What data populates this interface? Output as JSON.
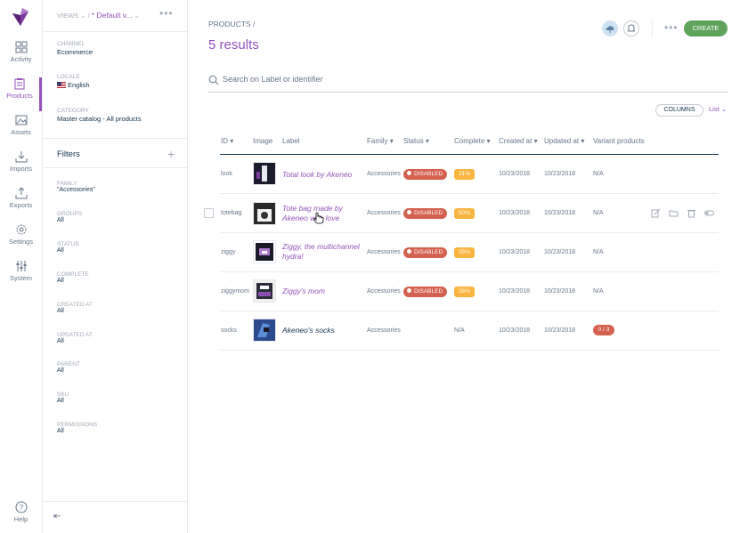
{
  "nav": {
    "items": [
      {
        "label": "Activity",
        "icon": "dashboard-icon"
      },
      {
        "label": "Products",
        "icon": "clipboard-icon"
      },
      {
        "label": "Assets",
        "icon": "image-icon"
      },
      {
        "label": "Imports",
        "icon": "download-icon"
      },
      {
        "label": "Exports",
        "icon": "upload-icon"
      },
      {
        "label": "Settings",
        "icon": "gear-icon"
      },
      {
        "label": "System",
        "icon": "sliders-icon"
      }
    ],
    "help": "Help"
  },
  "panel": {
    "views_label": "VIEWS",
    "view_name": "* Default v...",
    "channel_label": "CHANNEL",
    "channel_value": "Ecommerce",
    "locale_label": "LOCALE",
    "locale_value": "English",
    "category_label": "CATEGORY",
    "category_value": "Master catalog - All products",
    "filters_title": "Filters",
    "filters": [
      {
        "label": "FAMILY",
        "value": "\"Accessories\""
      },
      {
        "label": "GROUPS",
        "value": "All"
      },
      {
        "label": "STATUS",
        "value": "All"
      },
      {
        "label": "COMPLETE",
        "value": "All"
      },
      {
        "label": "CREATED AT",
        "value": "All"
      },
      {
        "label": "UPDATED AT",
        "value": "All"
      },
      {
        "label": "PARENT",
        "value": "All"
      },
      {
        "label": "SKU",
        "value": "All"
      },
      {
        "label": "PERMISSIONS",
        "value": "All"
      }
    ]
  },
  "header": {
    "breadcrumb": "PRODUCTS /",
    "results": "5 results",
    "create_label": "CREATE"
  },
  "search": {
    "placeholder": "Search on Label or identifier"
  },
  "toolbar": {
    "columns_label": "COLUMNS",
    "display_label": "List"
  },
  "table": {
    "headers": [
      "ID",
      "Image",
      "Label",
      "Family",
      "Status",
      "Complete",
      "Created at",
      "Updated at",
      "Variant products"
    ],
    "rows": [
      {
        "id": "look",
        "label": "Total look by Akeneo",
        "family": "Accessories",
        "status": "DISABLED",
        "complete": "21%",
        "created": "10/23/2018",
        "updated": "10/23/2018",
        "variant": "N/A"
      },
      {
        "id": "totebag",
        "label": "Tote bag made by Akeneo with love",
        "family": "Accessories",
        "status": "DISABLED",
        "complete": "50%",
        "created": "10/23/2018",
        "updated": "10/23/2018",
        "variant": "N/A"
      },
      {
        "id": "ziggy",
        "label": "Ziggy, the multichannel hydra!",
        "family": "Accessories",
        "status": "DISABLED",
        "complete": "35%",
        "created": "10/23/2018",
        "updated": "10/23/2018",
        "variant": "N/A"
      },
      {
        "id": "ziggymom",
        "label": "Ziggy's mom",
        "family": "Accessories",
        "status": "DISABLED",
        "complete": "28%",
        "created": "10/23/2018",
        "updated": "10/23/2018",
        "variant": "N/A"
      },
      {
        "id": "socks",
        "label": "Akeneo's socks",
        "family": "Accessories",
        "status": "",
        "complete": "N/A",
        "created": "10/23/2018",
        "updated": "10/23/2018",
        "variant": "0 / 3"
      }
    ]
  },
  "colors": {
    "accent": "#9452ba",
    "success": "#5fa25c",
    "danger": "#d4604f",
    "warning": "#f9b53f"
  }
}
